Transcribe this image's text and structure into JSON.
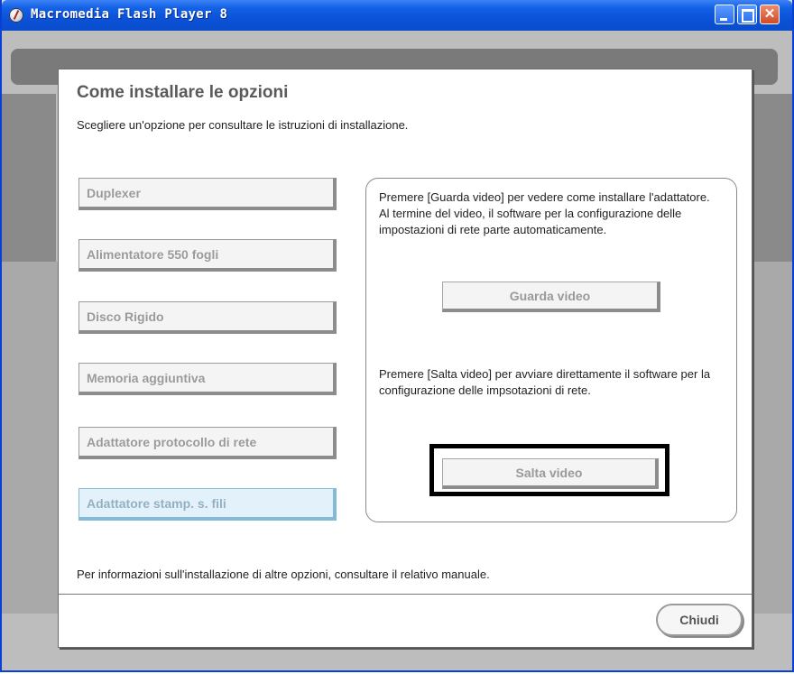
{
  "window": {
    "title": "Macromedia Flash Player 8"
  },
  "dialog": {
    "title": "Come installare le opzioni",
    "subtitle": "Scegliere un'opzione per consultare le istruzioni di installazione.",
    "options": [
      {
        "label": "Duplexer"
      },
      {
        "label": "Alimentatore 550 fogli"
      },
      {
        "label": "Disco Rigido"
      },
      {
        "label": "Memoria aggiuntiva"
      },
      {
        "label": "Adattatore protocollo di rete"
      },
      {
        "label": "Adattatore stamp. s. fili",
        "selected": true
      }
    ],
    "panel": {
      "watch_text": "Premere [Guarda video] per vedere come installare l'adattatore. Al termine del video, il software per la configurazione delle impostazioni di rete parte automaticamente.",
      "watch_button": "Guarda video",
      "skip_text": "Premere [Salta video] per avviare direttamente il software per la configurazione delle impsotazioni di rete.",
      "skip_button": "Salta video"
    },
    "footer_text": "Per informazioni sull'installazione di altre opzioni, consultare il relativo manuale.",
    "close_button": "Chiudi"
  },
  "colors": {
    "titlebar": "#0b52d8",
    "selected_option_bg": "#e3f1fb",
    "highlight_border": "#000000"
  }
}
